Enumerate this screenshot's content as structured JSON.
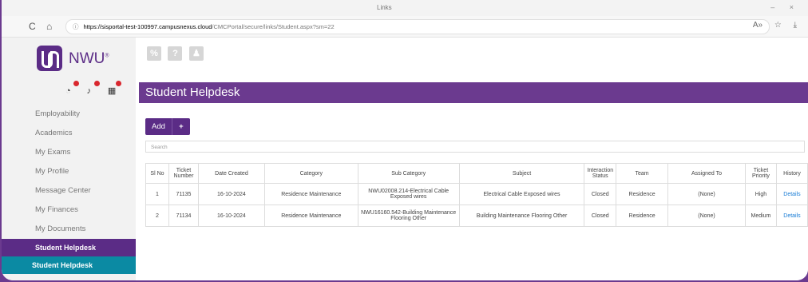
{
  "browser": {
    "tab_title": "Links",
    "window_controls": "–  ×",
    "url_host": "https://sisportal-test-100997.campusnexus.cloud",
    "url_path": "/CMCPortal/secure/links/Student.aspx?sm=22",
    "nav_back": "C",
    "nav_home": "⌂",
    "lock": "ⓘ",
    "right_icons": [
      "A»",
      "☆",
      "⤓"
    ]
  },
  "logo": {
    "text": "NWU",
    "registered": "®"
  },
  "alerts": [
    {
      "icon": "clock-icon",
      "glyph": "◔"
    },
    {
      "icon": "bell-icon",
      "glyph": "♪"
    },
    {
      "icon": "calendar-icon",
      "glyph": "▦"
    }
  ],
  "menu": [
    "Employability",
    "Academics",
    "My Exams",
    "My Profile",
    "Message Center",
    "My Finances",
    "My Documents"
  ],
  "menu_active": "Student Helpdesk",
  "menu_sub": "Student Helpdesk",
  "toolbar_icons": [
    "%",
    "?",
    "♟"
  ],
  "page": {
    "title": "Student Helpdesk",
    "add_label": "Add",
    "add_plus": "+",
    "search_placeholder": "Search"
  },
  "table": {
    "headers": [
      "Sl No",
      "Ticket Number",
      "Date Created",
      "Category",
      "Sub Category",
      "Subject",
      "Interaction Status",
      "Team",
      "Assigned To",
      "Ticket Priority",
      "History"
    ],
    "rows": [
      [
        "1",
        "71135",
        "16-10-2024",
        "Residence Maintenance",
        "NWU02008.214-Electrical Cable Exposed wires",
        "Electrical Cable Exposed wires",
        "Closed",
        "Residence",
        "(None)",
        "High",
        "Details"
      ],
      [
        "2",
        "71134",
        "16-10-2024",
        "Residence Maintenance",
        "NWU16160.542-Building Maintenance Flooring Other",
        "Building Maintenance Flooring Other",
        "Closed",
        "Residence",
        "(None)",
        "Medium",
        "Details"
      ]
    ]
  },
  "colors": {
    "purple": "#6b3a8f",
    "teal": "#0b8aa3",
    "link": "#1a7dd6",
    "badge": "#d9272e"
  }
}
